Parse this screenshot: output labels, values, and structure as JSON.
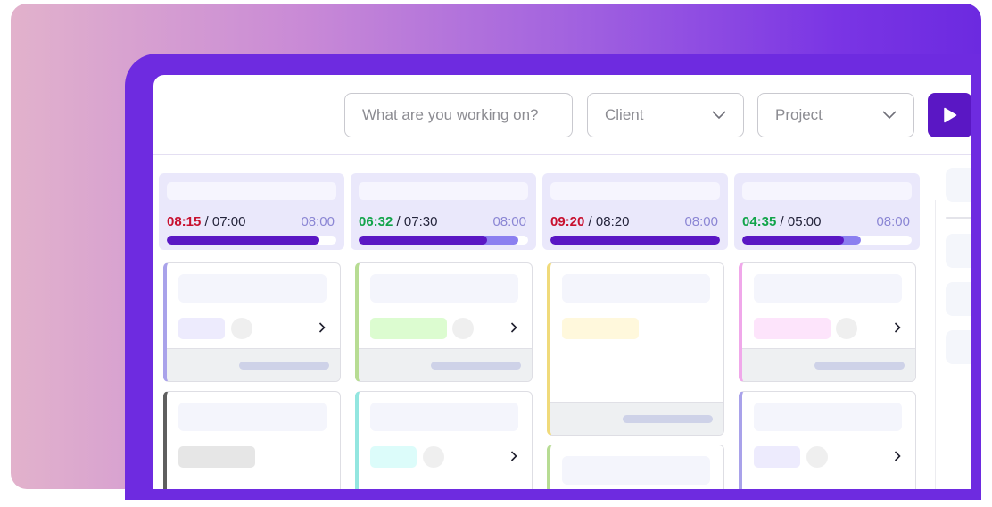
{
  "toolbar": {
    "search_placeholder": "What are you working on?",
    "client_label": "Client",
    "project_label": "Project",
    "play_icon": "play-icon",
    "dropdown_icon": "chevron-down-icon"
  },
  "colors": {
    "accent": "#5a17c4",
    "over": "#c8102e",
    "under": "#12a44a",
    "capacity": "#8b86d4"
  },
  "columns": [
    {
      "spent": "08:15",
      "planned": "07:00",
      "capacity": "08:00",
      "status": "over",
      "planned_pct": 90,
      "spent_pct": 90
    },
    {
      "spent": "06:32",
      "planned": "07:30",
      "capacity": "08:00",
      "status": "under",
      "planned_pct": 94,
      "spent_pct": 76
    },
    {
      "spent": "09:20",
      "planned": "08:20",
      "capacity": "08:00",
      "status": "over",
      "planned_pct": 100,
      "spent_pct": 100
    },
    {
      "spent": "04:35",
      "planned": "05:00",
      "capacity": "08:00",
      "status": "under",
      "planned_pct": 70,
      "spent_pct": 60
    }
  ],
  "separator": "/"
}
